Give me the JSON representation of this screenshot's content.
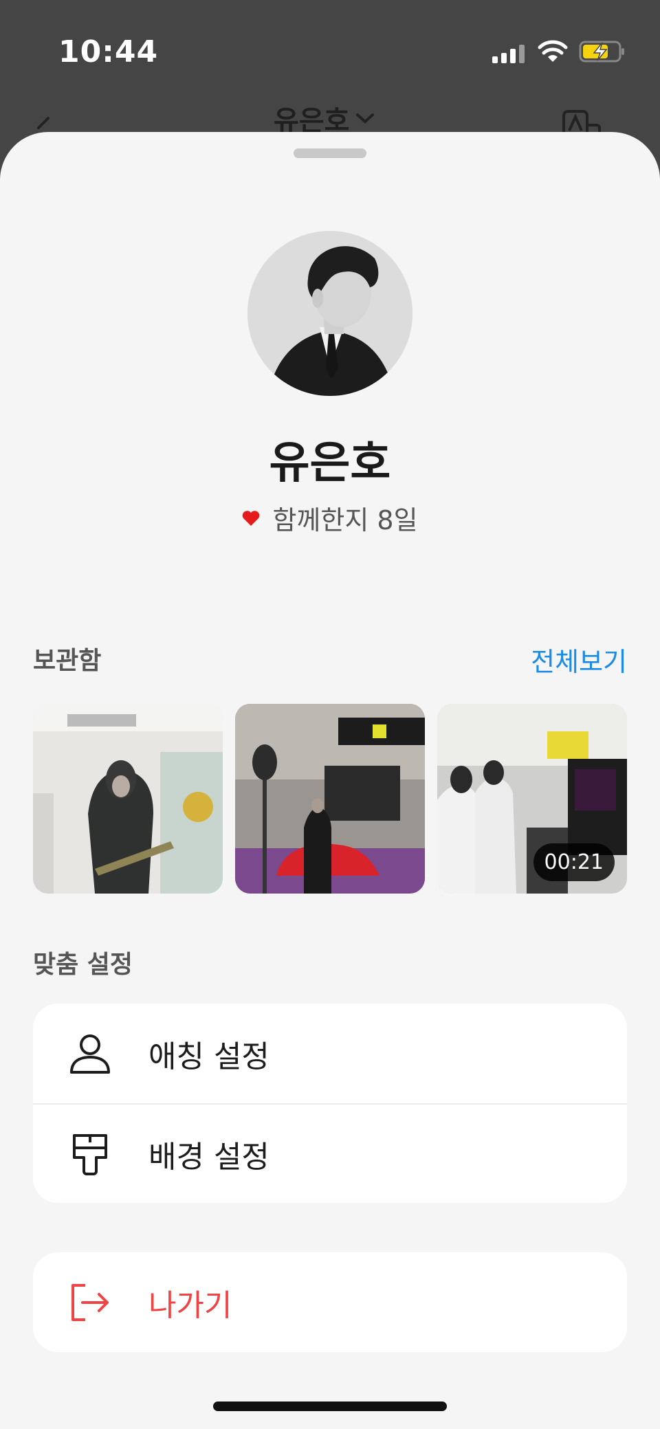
{
  "status_bar": {
    "time": "10:44"
  },
  "nav": {
    "title": "유은호"
  },
  "profile": {
    "name": "유은호",
    "together_text": "함께한지 8일"
  },
  "archive": {
    "title": "보관함",
    "see_all": "전체보기",
    "items": [
      {
        "type": "photo"
      },
      {
        "type": "photo"
      },
      {
        "type": "video",
        "duration": "00:21"
      }
    ]
  },
  "settings": {
    "title": "맞춤 설정",
    "items": [
      {
        "label": "애칭 설정",
        "icon": "person-icon"
      },
      {
        "label": "배경 설정",
        "icon": "paint-roller-icon"
      }
    ]
  },
  "exit": {
    "label": "나가기",
    "icon": "exit-icon"
  },
  "colors": {
    "accent": "#1a8be8",
    "danger": "#f04444",
    "heart": "#e61b1b",
    "sheet_bg": "#f5f5f5"
  }
}
